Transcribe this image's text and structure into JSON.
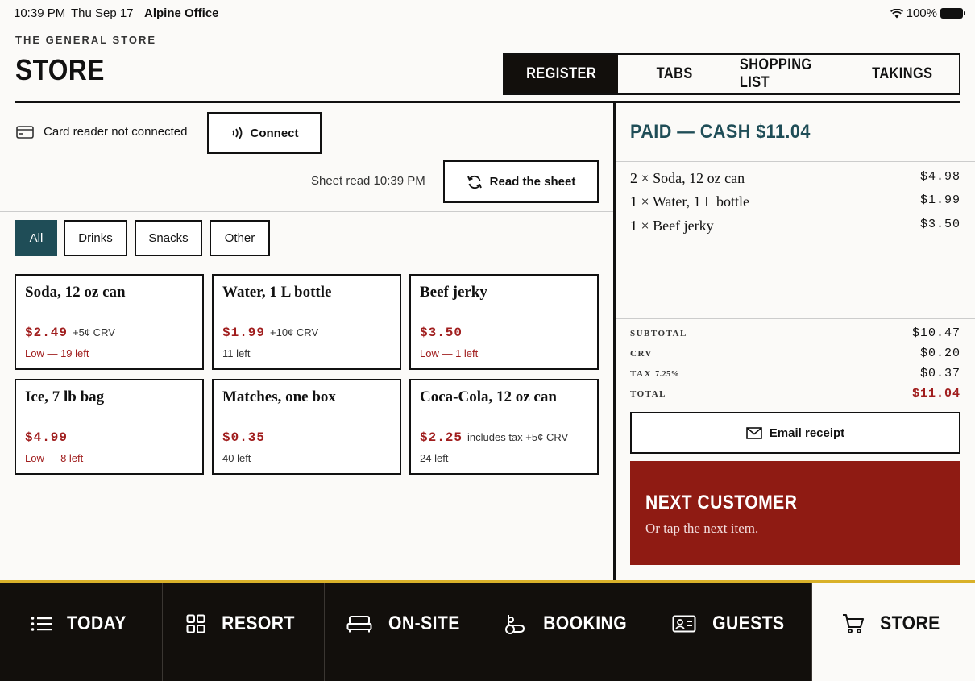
{
  "status_bar": {
    "time": "10:39 PM",
    "date": "Thu Sep 17",
    "carrier": "Alpine Office",
    "battery": "100%"
  },
  "header": {
    "eyebrow": "THE GENERAL STORE",
    "title": "STORE"
  },
  "tabs": [
    {
      "label": "REGISTER",
      "active": true
    },
    {
      "label": "TABS",
      "active": false
    },
    {
      "label": "SHOPPING LIST",
      "active": false
    },
    {
      "label": "TAKINGS",
      "active": false
    }
  ],
  "card_reader": {
    "status": "Card reader not connected",
    "connect_label": "Connect"
  },
  "sheet": {
    "status": "Sheet read 10:39  PM",
    "read_label": "Read the sheet"
  },
  "filters": [
    {
      "label": "All",
      "active": true
    },
    {
      "label": "Drinks",
      "active": false
    },
    {
      "label": "Snacks",
      "active": false
    },
    {
      "label": "Other",
      "active": false
    }
  ],
  "products": [
    {
      "name": "Soda, 12 oz can",
      "price": "$2.49",
      "note": "+5¢ CRV",
      "stock": "Low — 19 left",
      "low": true
    },
    {
      "name": "Water, 1 L bottle",
      "price": "$1.99",
      "note": "+10¢ CRV",
      "stock": "11 left",
      "low": false
    },
    {
      "name": "Beef jerky",
      "price": "$3.50",
      "note": "",
      "stock": "Low — 1 left",
      "low": true
    },
    {
      "name": "Ice, 7 lb bag",
      "price": "$4.99",
      "note": "",
      "stock": "Low — 8 left",
      "low": true
    },
    {
      "name": "Matches, one box",
      "price": "$0.35",
      "note": "",
      "stock": "40 left",
      "low": false
    },
    {
      "name": "Coca-Cola, 12 oz can",
      "price": "$2.25",
      "note": "includes tax  +5¢ CRV",
      "stock": "24 left",
      "low": false
    }
  ],
  "receipt": {
    "title": "PAID — CASH $11.04",
    "items": [
      {
        "desc": "2 × Soda, 12 oz can",
        "amount": "$4.98"
      },
      {
        "desc": "1 × Water, 1 L bottle",
        "amount": "$1.99"
      },
      {
        "desc": "1 × Beef jerky",
        "amount": "$3.50"
      }
    ],
    "subtotal_label": "SUBTOTAL",
    "subtotal": "$10.47",
    "crv_label": "CRV",
    "crv": "$0.20",
    "tax_label": "TAX",
    "tax_rate": "7.25%",
    "tax": "$0.37",
    "total_label": "TOTAL",
    "total": "$11.04",
    "email_label": "Email receipt",
    "next_title": "NEXT CUSTOMER",
    "next_subtitle": "Or tap the next item."
  },
  "nav": [
    {
      "label": "TODAY",
      "icon": "list-icon",
      "active": false
    },
    {
      "label": "RESORT",
      "icon": "grid-icon",
      "active": false
    },
    {
      "label": "ON-SITE",
      "icon": "bed-icon",
      "active": false
    },
    {
      "label": "BOOKING",
      "icon": "booking-icon",
      "active": false
    },
    {
      "label": "GUESTS",
      "icon": "id-card-icon",
      "active": false
    },
    {
      "label": "STORE",
      "icon": "cart-icon",
      "active": true
    }
  ],
  "colors": {
    "accent": "#1f4d57",
    "price_red": "#a01d1d",
    "next_bg": "#8f1b13",
    "nav_bg": "#120f0c",
    "nav_rule": "#d9b12a"
  }
}
